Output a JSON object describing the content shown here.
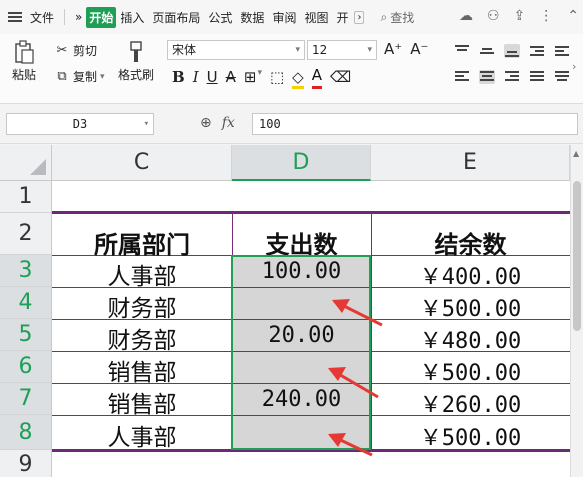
{
  "menubar": {
    "file_label": "文件",
    "more_label": "»",
    "tabs": [
      "开始",
      "插入",
      "页面布局",
      "公式",
      "数据",
      "审阅",
      "视图",
      "开"
    ],
    "search_label": "查找"
  },
  "ribbon": {
    "paste_label": "粘贴",
    "cut_label": "剪切",
    "copy_label": "复制",
    "format_painter_label": "格式刷",
    "font_name": "宋体",
    "font_size": "12",
    "bold": "B",
    "italic": "I",
    "underline": "U",
    "strike": "A",
    "font_color_glyph": "A"
  },
  "formula_bar": {
    "name_box": "D3",
    "fx_label": "fx",
    "formula": "100"
  },
  "columns": [
    "C",
    "D",
    "E"
  ],
  "rows": [
    "1",
    "2",
    "3",
    "4",
    "5",
    "6",
    "7",
    "8",
    "9"
  ],
  "table": {
    "headers": [
      "所属部门",
      "支出数",
      "结余数"
    ],
    "data": [
      {
        "dept": "人事部",
        "expense": "100.00",
        "balance": "￥400.00"
      },
      {
        "dept": "财务部",
        "expense": "",
        "balance": "￥500.00"
      },
      {
        "dept": "财务部",
        "expense": "20.00",
        "balance": "￥480.00"
      },
      {
        "dept": "销售部",
        "expense": "",
        "balance": "￥500.00"
      },
      {
        "dept": "销售部",
        "expense": "240.00",
        "balance": "￥260.00"
      },
      {
        "dept": "人事部",
        "expense": "",
        "balance": "￥500.00"
      }
    ]
  },
  "colors": {
    "accent_green": "#1e9f55",
    "border_purple": "#7a2c7a",
    "arrow_red": "#e53935",
    "selection_gray": "#d6d6d6"
  }
}
